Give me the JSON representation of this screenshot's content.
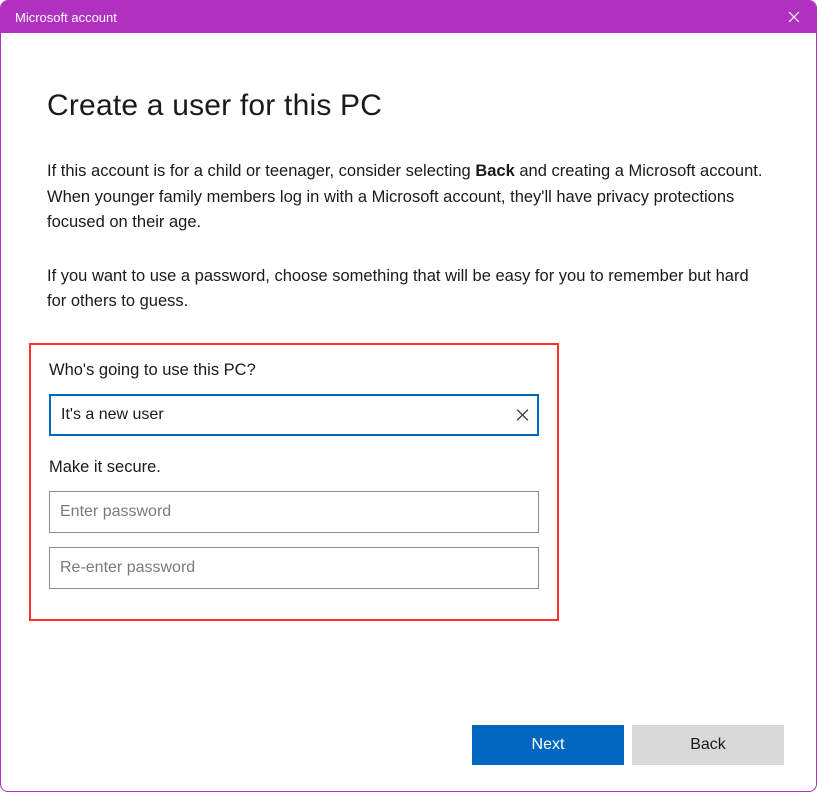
{
  "titlebar": {
    "title": "Microsoft account"
  },
  "heading": "Create a user for this PC",
  "paragraph1_pre": "If this account is for a child or teenager, consider selecting ",
  "paragraph1_bold": "Back",
  "paragraph1_post": " and creating a Microsoft account. When younger family members log in with a Microsoft account, they'll have privacy protections focused on their age.",
  "paragraph2": "If you want to use a password, choose something that will be easy for you to remember but hard for others to guess.",
  "form": {
    "who_label": "Who's going to use this PC?",
    "username_value": "It's a new user",
    "secure_label": "Make it secure.",
    "password_placeholder": "Enter password",
    "password2_placeholder": "Re-enter password"
  },
  "buttons": {
    "next": "Next",
    "back": "Back"
  },
  "colors": {
    "accent": "#0067c0",
    "titlebar": "#b030c0",
    "highlight_border": "#ff3030"
  }
}
